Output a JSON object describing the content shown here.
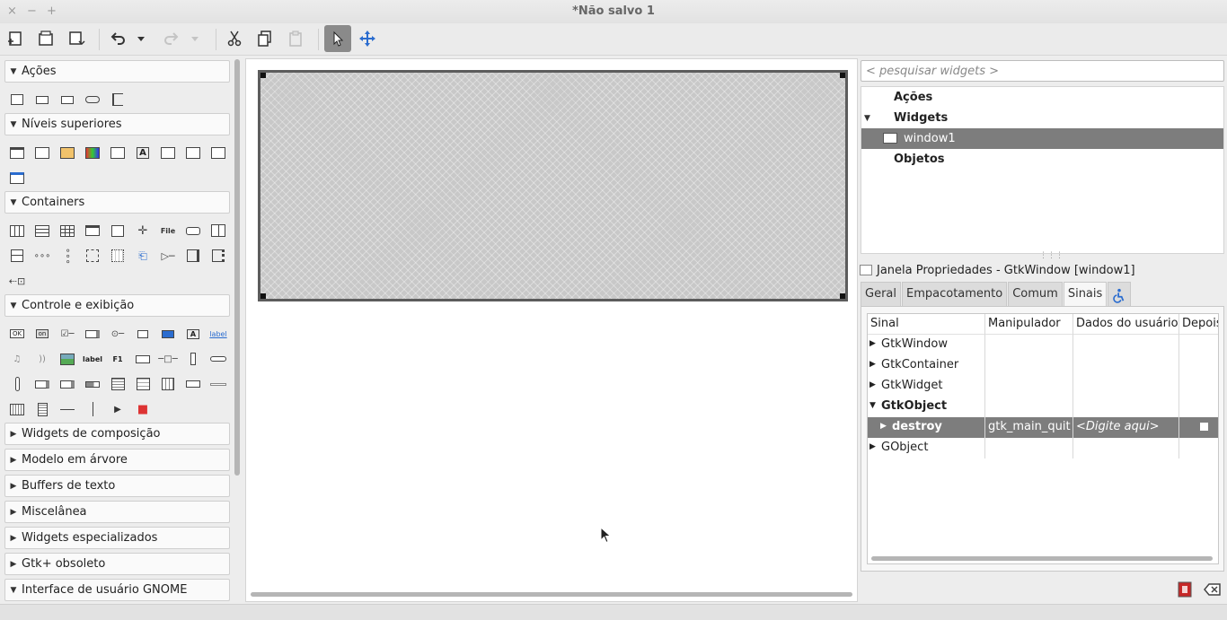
{
  "window": {
    "title": "*Não salvo 1",
    "controls": [
      "×",
      "−",
      "+"
    ]
  },
  "toolbar": {
    "items": [
      "new-icon",
      "open-icon",
      "save-icon",
      "undo-icon",
      "undo-dropdown-icon",
      "redo-icon",
      "redo-dropdown-icon",
      "cut-icon",
      "copy-icon",
      "paste-icon",
      "select-pointer-icon",
      "drag-resize-icon"
    ]
  },
  "palette": {
    "groups": [
      {
        "label": "Ações",
        "expanded": true
      },
      {
        "label": "Níveis superiores",
        "expanded": true
      },
      {
        "label": "Containers",
        "expanded": true
      },
      {
        "label": "Controle e exibição",
        "expanded": true
      },
      {
        "label": "Widgets de composição",
        "expanded": false
      },
      {
        "label": "Modelo em árvore",
        "expanded": false
      },
      {
        "label": "Buffers de texto",
        "expanded": false
      },
      {
        "label": "Miscelânea",
        "expanded": false
      },
      {
        "label": "Widgets especializados",
        "expanded": false
      },
      {
        "label": "Gtk+ obsoleto",
        "expanded": false
      },
      {
        "label": "Interface de usuário GNOME",
        "expanded": true
      }
    ],
    "arrows": {
      "expanded": "▼",
      "collapsed": "▶"
    },
    "widget_labels": {
      "file": "File",
      "label1": "label",
      "label2": "label",
      "f1": "F1",
      "ok": "OK",
      "on": "on"
    }
  },
  "inspector": {
    "search_placeholder": "< pesquisar widgets >",
    "tree": [
      {
        "label": "Ações",
        "bold": true,
        "expander": ""
      },
      {
        "label": "Widgets",
        "bold": true,
        "expander": "▼"
      },
      {
        "label": "window1",
        "bold": false,
        "expander": "",
        "selected": true
      },
      {
        "label": "Objetos",
        "bold": true,
        "expander": ""
      }
    ]
  },
  "properties": {
    "title": "Janela Propriedades - GtkWindow [window1]",
    "tabs": [
      "Geral",
      "Empacotamento",
      "Comum",
      "Sinais"
    ],
    "active_tab": "Sinais",
    "columns": [
      "Sinal",
      "Manipulador",
      "Dados do usuário",
      "Depois"
    ],
    "rows": [
      {
        "signal": "GtkWindow",
        "expander": "▶",
        "bold": false
      },
      {
        "signal": "GtkContainer",
        "expander": "▶",
        "bold": false
      },
      {
        "signal": "GtkWidget",
        "expander": "▶",
        "bold": false
      },
      {
        "signal": "GtkObject",
        "expander": "▼",
        "bold": true
      },
      {
        "signal": "destroy",
        "expander": "▶",
        "bold": true,
        "handler": "gtk_main_quit",
        "user_data": "<Digite aqui>",
        "after": false,
        "selected": true
      },
      {
        "signal": "GObject",
        "expander": "▶",
        "bold": false
      }
    ]
  },
  "colors": {
    "selection": "#7d7d7d",
    "accent_blue": "#2a6ccf"
  }
}
